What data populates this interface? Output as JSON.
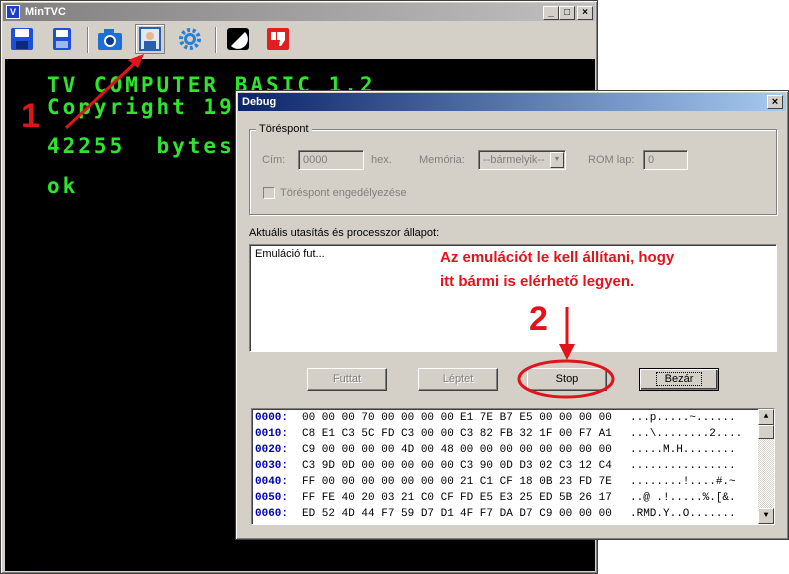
{
  "main_window": {
    "title": "MinTVC",
    "controls": {
      "minimize": "_",
      "maximize": "□",
      "close": "×"
    },
    "toolbar": [
      {
        "name": "save-icon",
        "color": "#1d4fd8"
      },
      {
        "name": "disk-icon",
        "color": "#1d4fd8"
      },
      {
        "name": "camera-icon",
        "color": "#1d6fd8"
      },
      {
        "name": "debug-icon",
        "color": "#2a5fb0"
      },
      {
        "name": "gear-icon",
        "color": "#2a7fd8"
      },
      {
        "name": "display-mode-icon",
        "color": "#000000"
      },
      {
        "name": "thumbs-down-icon",
        "color": "#e02020"
      }
    ],
    "screen": {
      "line1": "TV COMPUTER BASIC 1.2",
      "line2": "Copyright 19",
      "line3": "42255  bytes",
      "line4": "ok",
      "text_color": "#2ee52e"
    }
  },
  "annotations": {
    "step1": "1",
    "step2": "2",
    "note_line1": "Az emulációt le kell állítani, hogy",
    "note_line2": "itt bármi is elérhető legyen.",
    "color": "#e0141a"
  },
  "debug": {
    "title": "Debug",
    "close": "×",
    "breakpoint": {
      "group_label": "Töréspont",
      "addr_label": "Cím:",
      "addr_value": "0000",
      "hex_label": "hex.",
      "memory_label": "Memória:",
      "memory_value": "--bármelyik--",
      "rom_label": "ROM lap:",
      "rom_value": "0",
      "enable_label": "Töréspont engedélyezése"
    },
    "state": {
      "label": "Aktuális utasítás és processzor állapot:",
      "text": "Emuláció fut..."
    },
    "buttons": {
      "run": "Futtat",
      "step": "Léptet",
      "stop": "Stop",
      "close": "Bezár"
    },
    "hex_rows": [
      {
        "addr": "0000:",
        "b1": "00 00 00 70 00 00 00 00",
        "b2": "E1 7E B7 E5 00 00 00 00",
        "ascii": "...p.....~......"
      },
      {
        "addr": "0010:",
        "b1": "C8 E1 C3 5C FD C3 00 00",
        "b2": "C3 82 FB 32 1F 00 F7 A1",
        "ascii": "...\\........2...."
      },
      {
        "addr": "0020:",
        "b1": "C9 00 00 00 00 4D 00 48",
        "b2": "00 00 00 00 00 00 00 00",
        "ascii": ".....M.H........"
      },
      {
        "addr": "0030:",
        "b1": "C3 9D 0D 00 00 00 00 00",
        "b2": "C3 90 0D D3 02 C3 12 C4",
        "ascii": "................"
      },
      {
        "addr": "0040:",
        "b1": "FF 00 00 00 00 00 00 00",
        "b2": "21 C1 CF 18 0B 23 FD 7E",
        "ascii": "........!....#.~"
      },
      {
        "addr": "0050:",
        "b1": "FF FE 40 20 03 21 C0 CF",
        "b2": "FD E5 E3 25 ED 5B 26 17",
        "ascii": "..@ .!.....%.[&."
      },
      {
        "addr": "0060:",
        "b1": "ED 52 4D 44 F7 59 D7 D1",
        "b2": "4F F7 DA D7 C9 00 00 00",
        "ascii": ".RMD.Y..O......."
      }
    ]
  }
}
